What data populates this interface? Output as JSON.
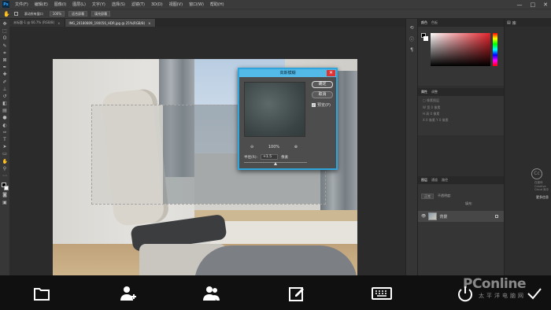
{
  "menubar": {
    "logo": "Ps",
    "items": [
      "文件(F)",
      "编辑(E)",
      "图像(I)",
      "图层(L)",
      "文字(Y)",
      "选择(S)",
      "滤镜(T)",
      "3D(D)",
      "视图(V)",
      "窗口(W)",
      "帮助(H)"
    ],
    "minimize": "—",
    "maximize": "□",
    "close": "✕"
  },
  "optionsbar": {
    "scroll_all": "滚动所有窗口",
    "zoom": "100%",
    "fit_screen": "适合屏幕",
    "fill_screen": "填充屏幕"
  },
  "tabs": [
    {
      "label": "未标题-1 @ 66.7% (RGB/8)",
      "active": false
    },
    {
      "label": "IMG_20180809_190056_HDR.jpg @ 25%(RGB/8)",
      "active": true
    }
  ],
  "dialog": {
    "title": "高斯模糊",
    "close": "✕",
    "ok": "确定",
    "cancel": "取消",
    "preview_label": "预览(P)",
    "preview_checked": true,
    "zoom_out": "⊖",
    "zoom_level": "100%",
    "zoom_in": "⊕",
    "radius_label": "半径(R):",
    "radius_value": "+1.5",
    "radius_unit": "像素",
    "slider_position": 0.5
  },
  "panels": {
    "color_tabs": [
      "颜色",
      "色板"
    ],
    "adj_tabs": [
      "属性",
      "调整"
    ],
    "adj_rows": [
      "□ 像素图层",
      "W 宽 0 像素",
      "H 高 0 像素",
      "X 0 像素 Y 0 像素"
    ],
    "layers_tabs": [
      "图层",
      "通道",
      "路径"
    ],
    "blend_mode": "正常",
    "opacity_label": "不透明度:",
    "fill_label": "填充:",
    "layer_name": "背景"
  },
  "right_strip": {
    "header": "库",
    "cc_logo": "Cc",
    "cc_text": "在媒体 Creative Cloud 库中",
    "cc_link": "更多信息"
  },
  "bottombar": {
    "icons": [
      "folder-icon",
      "add-user-icon",
      "users-icon",
      "edit-icon",
      "keyboard-icon",
      "power-icon",
      "check-icon"
    ]
  },
  "watermark": {
    "main": "PConline",
    "sub": "太平洋电脑网"
  }
}
